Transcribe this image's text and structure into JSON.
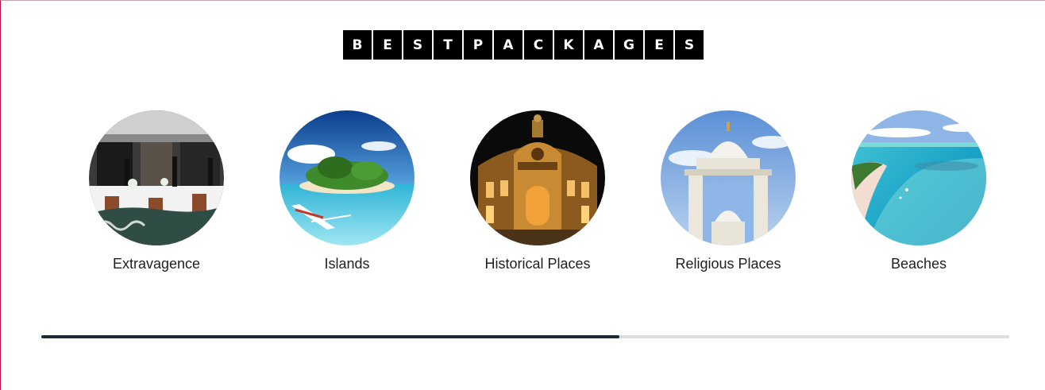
{
  "section": {
    "title_letters": [
      "B",
      "E",
      "S",
      "T",
      "P",
      "A",
      "C",
      "K",
      "A",
      "G",
      "E",
      "S"
    ]
  },
  "packages": [
    {
      "label": "Extravagence",
      "image": "restaurant-terrace-image"
    },
    {
      "label": "Islands",
      "image": "tropical-island-image"
    },
    {
      "label": "Historical Places",
      "image": "night-opera-house-image"
    },
    {
      "label": "Religious Places",
      "image": "white-temple-image"
    },
    {
      "label": "Beaches",
      "image": "turquoise-lagoon-image"
    }
  ],
  "carousel": {
    "progress": 0.597
  },
  "colors": {
    "title_bg": "#000000",
    "title_fg": "#ffffff",
    "progress_fill": "#1c2733",
    "progress_track": "#dcdcdc"
  }
}
